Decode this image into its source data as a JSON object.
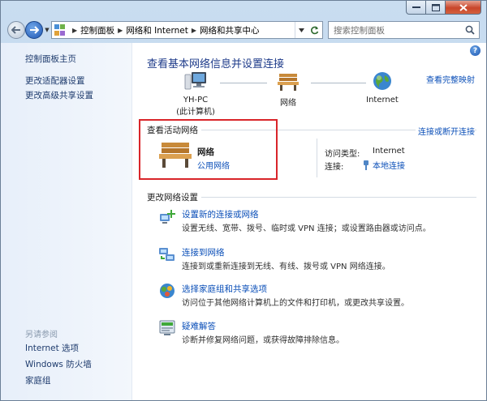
{
  "window": {
    "controls": {
      "minimize": "—",
      "maximize": "▢",
      "close": "✕"
    }
  },
  "address": {
    "breadcrumbs": [
      "控制面板",
      "网络和 Internet",
      "网络和共享中心"
    ],
    "search_placeholder": "搜索控制面板"
  },
  "sidebar": {
    "items": [
      "控制面板主页",
      "更改适配器设置",
      "更改高级共享设置"
    ],
    "see_also_label": "另请参阅",
    "see_also": [
      "Internet 选项",
      "Windows 防火墙",
      "家庭组"
    ]
  },
  "main": {
    "title": "查看基本网络信息并设置连接",
    "full_map_link": "查看完整映射",
    "map": {
      "computer_name": "YH-PC",
      "computer_sub": "(此计算机)",
      "network": "网络",
      "internet": "Internet"
    },
    "active": {
      "heading": "查看活动网络",
      "connect_link": "连接或断开连接",
      "network_name": "网络",
      "network_type": "公用网络",
      "access_type_label": "访问类型:",
      "access_type_value": "Internet",
      "connection_label": "连接:",
      "connection_value": "本地连接"
    },
    "change": {
      "heading": "更改网络设置",
      "tasks": [
        {
          "title": "设置新的连接或网络",
          "desc": "设置无线、宽带、拨号、临时或 VPN 连接；或设置路由器或访问点。",
          "icon": "new-connection-icon"
        },
        {
          "title": "连接到网络",
          "desc": "连接到或重新连接到无线、有线、拨号或 VPN 网络连接。",
          "icon": "connect-network-icon"
        },
        {
          "title": "选择家庭组和共享选项",
          "desc": "访问位于其他网络计算机上的文件和打印机，或更改共享设置。",
          "icon": "homegroup-icon"
        },
        {
          "title": "疑难解答",
          "desc": "诊断并修复网络问题，或获得故障排除信息。",
          "icon": "troubleshoot-icon"
        }
      ]
    }
  },
  "colors": {
    "link": "#0b4fb8",
    "title": "#1e3b8a",
    "highlight": "#d9252a"
  }
}
